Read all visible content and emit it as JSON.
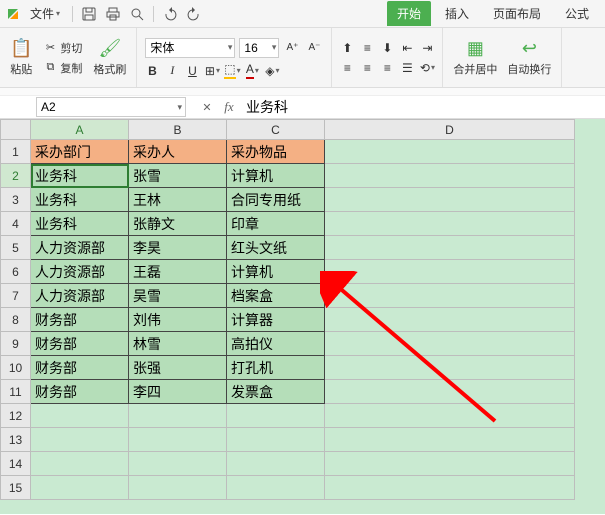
{
  "menubar": {
    "file_label": "文件",
    "tabs": {
      "begin": "开始",
      "insert": "插入",
      "page_layout": "页面布局",
      "formulas": "公式"
    }
  },
  "ribbon": {
    "paste": "粘贴",
    "cut": "剪切",
    "copy": "复制",
    "format_painter": "格式刷",
    "font_name": "宋体",
    "font_size": "16",
    "merge_center": "合并居中",
    "wrap_text": "自动换行"
  },
  "formula_bar": {
    "name_box": "A2",
    "formula_value": "业务科"
  },
  "columns": [
    "A",
    "B",
    "C",
    "D"
  ],
  "row_numbers": [
    "1",
    "2",
    "3",
    "4",
    "5",
    "6",
    "7",
    "8",
    "9",
    "10",
    "11",
    "12",
    "13",
    "14",
    "15"
  ],
  "active_cell": "A2",
  "header_row": {
    "c0": "采办部门",
    "c1": "采办人",
    "c2": "采办物品"
  },
  "rows": [
    {
      "c0": "业务科",
      "c1": "张雪",
      "c2": "计算机"
    },
    {
      "c0": "业务科",
      "c1": "王林",
      "c2": "合同专用纸"
    },
    {
      "c0": "业务科",
      "c1": "张静文",
      "c2": "印章"
    },
    {
      "c0": "人力资源部",
      "c1": "李昊",
      "c2": "红头文纸"
    },
    {
      "c0": "人力资源部",
      "c1": "王磊",
      "c2": "计算机"
    },
    {
      "c0": "人力资源部",
      "c1": "吴雪",
      "c2": "档案盒"
    },
    {
      "c0": "财务部",
      "c1": "刘伟",
      "c2": "计算器"
    },
    {
      "c0": "财务部",
      "c1": "林雪",
      "c2": "高拍仪"
    },
    {
      "c0": "财务部",
      "c1": "张强",
      "c2": "打孔机"
    },
    {
      "c0": "财务部",
      "c1": "李四",
      "c2": "发票盒"
    }
  ]
}
